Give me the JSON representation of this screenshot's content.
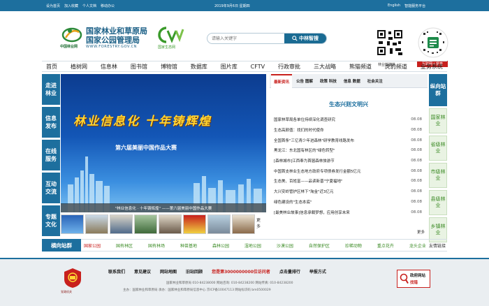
{
  "topbar": {
    "links": [
      "设为首页",
      "加入收藏",
      "个人文档",
      "移动办公"
    ],
    "date": "2019年9月6日 星期四",
    "english": "English",
    "platform": "智能服务平台"
  },
  "header": {
    "org_line1": "国家林业和草原局",
    "org_line2": "国家公园管理局",
    "url": "WWW.FORESTRY.GOV.CN",
    "logo_caption": "中国林业网",
    "cev_caption": "国家生态网",
    "search_placeholder": "请输入关键字",
    "search_button": "中林智搜",
    "qr1_caption": "林业新媒体",
    "qr2_caption": "互联网＋督查"
  },
  "nav": [
    "首页",
    "植树网",
    "信息林",
    "图书馆",
    "博物馆",
    "数据库",
    "图片库",
    "CFTV",
    "行政审批",
    "三大战略",
    "熊猫频道",
    "虎豹频道",
    "业务系统"
  ],
  "left_sidebar": [
    "走进林业",
    "信息发布",
    "在线服务",
    "互动交流",
    "专题文化"
  ],
  "slide": {
    "headline": "林业信息化  十年铸辉煌",
    "subtitle": "第六届美丽中国作品大赛",
    "caption": "\"林业信息化 · 十年铸辉煌\" ——第六届美丽中国作品大赛",
    "more": "更多"
  },
  "news": {
    "tabs": [
      "最新资讯",
      "公告 图解",
      "政策 科技",
      "信息 数据",
      "社会关注"
    ],
    "section_title": "生态兴则文明兴",
    "items": [
      {
        "title": "国家林草局各单位持续深化调查研究",
        "date": "08.08"
      },
      {
        "title": "生态高颜值：找们的时代使命",
        "date": "08.08"
      },
      {
        "title": "全国首条\"三亿青少年进森林\"研学教育线路发布",
        "date": "08.08"
      },
      {
        "title": "黑龙江：东北国有林区的\"绿色转型\"",
        "date": "08.08"
      },
      {
        "title": "[森林城市]江西奉为首届森林旅游节",
        "date": "08.08"
      },
      {
        "title": "中国首支林业生态地方政府专项债券发行金额5亿元",
        "date": "08.08"
      },
      {
        "title": "生态美、百姓富——品读新晋\"宁夏福地\"",
        "date": "08.08"
      },
      {
        "title": "大兴安岭管护区林下\"淘金\"近3亿元",
        "date": "08.08"
      },
      {
        "title": "绿色建设的\"生态本底\"",
        "date": "08.08"
      },
      {
        "title": "[最美林业故事]信息承载梦想，应用创享未来",
        "date": "08.08"
      }
    ],
    "more": "更多"
  },
  "right_sidebar": {
    "title": "纵向站群",
    "items": [
      "国家林业",
      "省级林业",
      "市级林业",
      "县级林业",
      "乡镇林业"
    ]
  },
  "hstations": {
    "label": "横向站群",
    "items": [
      "国家公园",
      "国有林区",
      "国有林场",
      "种苗基地",
      "森林公园",
      "湿地公园",
      "沙漠公园",
      "自然保护区",
      "珍稀动物",
      "重点花卉",
      "龙头企业"
    ],
    "tail": "友情链接"
  },
  "footer": {
    "links": [
      "联系我们",
      "意见建议",
      "网站地图",
      "旧站回顾"
    ],
    "visitor": "您是第3000000000位访问者",
    "rank": "点击量排行",
    "ack": "举报方式",
    "info1": "国家林业和草原局  010-84238000  网站咨询: 010-84238200  网站传真: 010-84238200",
    "info2": "主办：国家林业和草原局  承办：国家林业和草原局信息中心  京ICP备10047113  网站标识码 bm0500029",
    "seal_caption": "党政机关",
    "err_line1": "政府网站",
    "err_line2": "找错"
  },
  "colors": {
    "primary": "#1d6f9e",
    "accent_red": "#c8201d",
    "green": "#3a8a24"
  }
}
